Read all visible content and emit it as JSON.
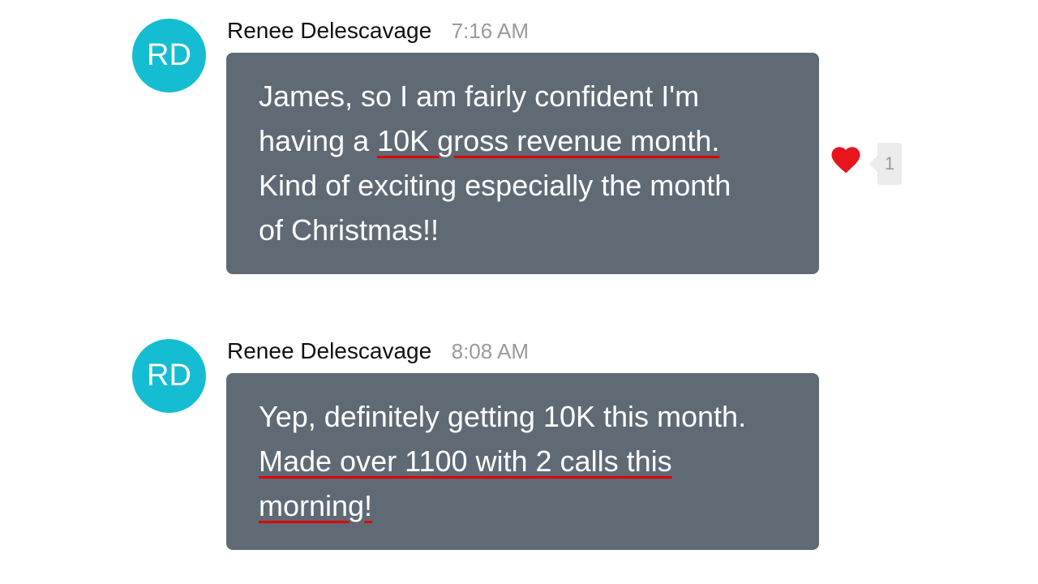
{
  "messages": [
    {
      "avatar_initials": "RD",
      "sender": "Renee Delescavage",
      "time": "7:16 AM",
      "lines": [
        {
          "plain": "James, so I am fairly confident I'm",
          "highlight": ""
        },
        {
          "plain": "having a ",
          "highlight": "10K gross revenue month."
        },
        {
          "plain": "Kind of exciting especially the month",
          "highlight": ""
        },
        {
          "plain": "of Christmas!!",
          "highlight": ""
        }
      ],
      "reaction": {
        "icon": "heart-icon",
        "color": "#e8141e",
        "count": "1"
      }
    },
    {
      "avatar_initials": "RD",
      "sender": "Renee Delescavage",
      "time": "8:08 AM",
      "lines": [
        {
          "plain": "Yep, definitely getting 10K this month.",
          "highlight": ""
        },
        {
          "plain": "",
          "highlight": "Made over 1100 with 2 calls this"
        },
        {
          "plain": "",
          "highlight": "morning!"
        }
      ]
    }
  ],
  "colors": {
    "avatar": "#15bdd3",
    "bubble": "#5f6a75",
    "underline": "#e00000"
  }
}
